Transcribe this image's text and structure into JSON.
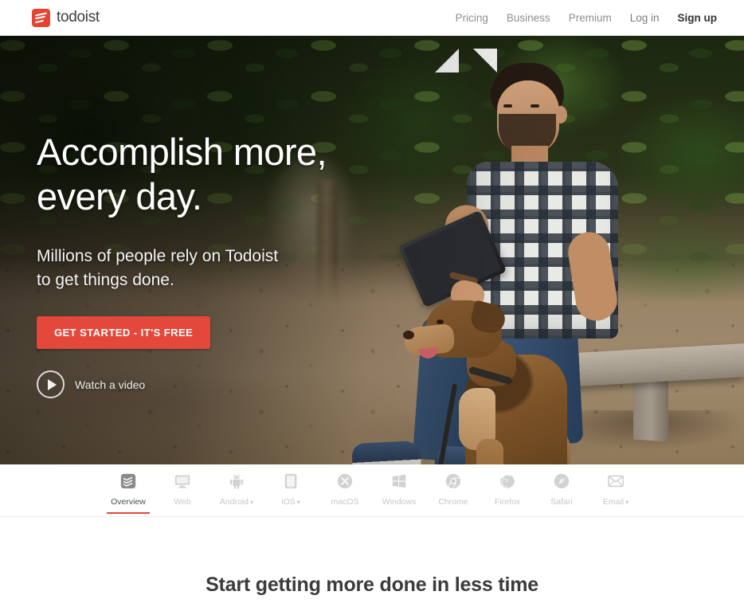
{
  "navbar": {
    "brand": "todoist",
    "brand_icon": "todoist-logo-icon",
    "brand_color": "#e44332",
    "links": [
      {
        "label": "Pricing",
        "name": "nav-link-pricing"
      },
      {
        "label": "Business",
        "name": "nav-link-business"
      },
      {
        "label": "Premium",
        "name": "nav-link-premium"
      },
      {
        "label": "Log in",
        "name": "nav-link-login"
      },
      {
        "label": "Sign up",
        "name": "nav-link-signup"
      }
    ]
  },
  "hero": {
    "title_line1": "Accomplish more,",
    "title_line2": "every day.",
    "subtitle_line1": "Millions of people rely on Todoist",
    "subtitle_line2": "to get things done.",
    "cta_label": "GET STARTED - IT'S FREE",
    "cta_color": "#e4483a",
    "video_label": "Watch a video",
    "video_icon": "play-circle-icon"
  },
  "platforms": {
    "accent_color": "#e4483a",
    "items": [
      {
        "label": "Overview",
        "icon": "todoist-overview-icon",
        "active": true,
        "caret": false
      },
      {
        "label": "Web",
        "icon": "monitor-icon",
        "active": false,
        "caret": false
      },
      {
        "label": "Android",
        "icon": "android-icon",
        "active": false,
        "caret": true
      },
      {
        "label": "iOS",
        "icon": "phone-icon",
        "active": false,
        "caret": true
      },
      {
        "label": "macOS",
        "icon": "apple-macos-icon",
        "active": false,
        "caret": false
      },
      {
        "label": "Windows",
        "icon": "windows-icon",
        "active": false,
        "caret": false
      },
      {
        "label": "Chrome",
        "icon": "chrome-icon",
        "active": false,
        "caret": false
      },
      {
        "label": "Firefox",
        "icon": "firefox-icon",
        "active": false,
        "caret": false
      },
      {
        "label": "Safari",
        "icon": "safari-icon",
        "active": false,
        "caret": false
      },
      {
        "label": "Email",
        "icon": "envelope-icon",
        "active": false,
        "caret": true
      }
    ]
  },
  "bottom": {
    "title": "Start getting more done in less time"
  }
}
